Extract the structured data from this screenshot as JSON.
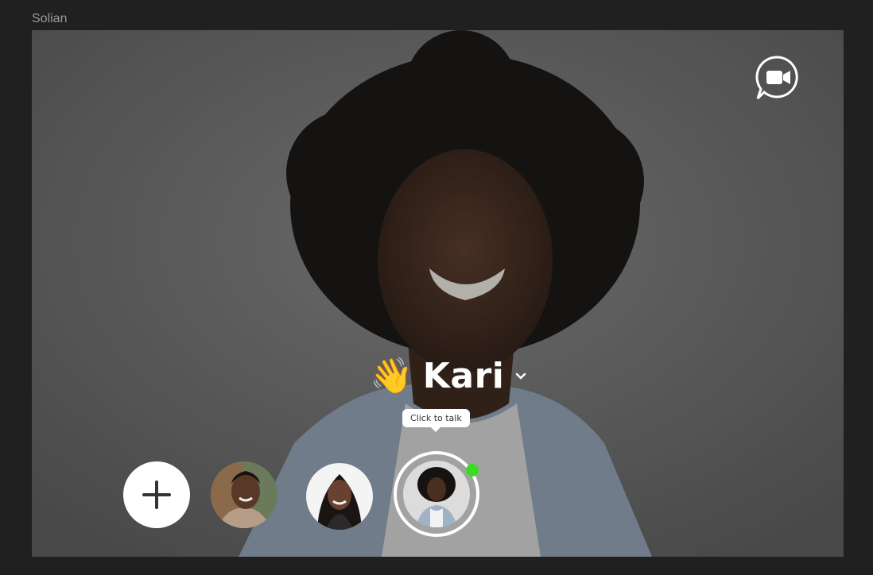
{
  "app": {
    "title": "Solian"
  },
  "greeting": {
    "emoji": "👋",
    "name": "Kari"
  },
  "tooltip": {
    "text": "Click to talk"
  },
  "icons": {
    "video_chat": "video-chat-icon",
    "add": "plus-icon",
    "dropdown": "chevron-down-icon"
  },
  "contacts": [
    {
      "id": "contact-1",
      "selected": false,
      "online": false
    },
    {
      "id": "contact-2",
      "selected": false,
      "online": false
    },
    {
      "id": "contact-3",
      "selected": true,
      "online": true
    }
  ],
  "colors": {
    "background": "#202020",
    "online": "#3adb22",
    "text": "#ffffff"
  }
}
